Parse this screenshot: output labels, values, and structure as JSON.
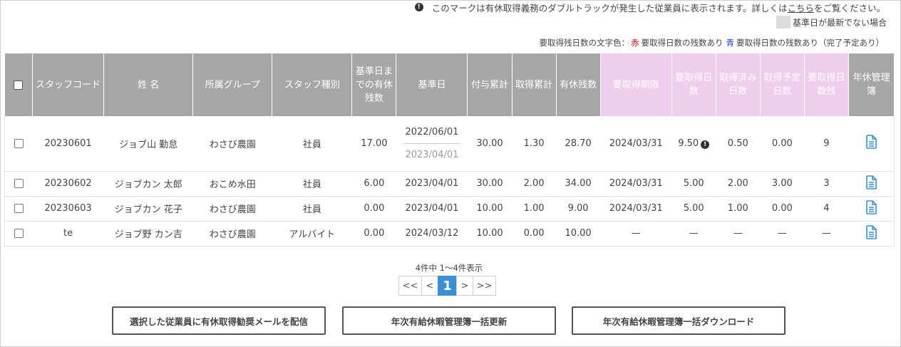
{
  "notice": {
    "icon": "exclamation-circle-icon",
    "text_before": "このマークは有休取得義務のダブルトラックが発生した従業員に表示されます。詳しくは",
    "link": "こちら",
    "text_after": "をご覧ください。"
  },
  "legend": {
    "swatch_color": "#dcdcdc",
    "label": "基準日が最新でない場合"
  },
  "color_legend": {
    "prefix": "要取得残日数の文字色：",
    "red_word": "赤",
    "red_desc": "要取得日数の残数あり",
    "blue_word": "青",
    "blue_desc": "要取得日数の残数あり（完了予定あり）"
  },
  "columns": [
    {
      "key": "check",
      "label": ""
    },
    {
      "key": "staff_code",
      "label": "スタッフコード"
    },
    {
      "key": "name",
      "label": "姓 名"
    },
    {
      "key": "group",
      "label": "所属グループ"
    },
    {
      "key": "staff_type",
      "label": "スタッフ種別"
    },
    {
      "key": "remain_before",
      "label": "基準日までの有休残数"
    },
    {
      "key": "base_date",
      "label": "基準日"
    },
    {
      "key": "granted_total",
      "label": "付与累計"
    },
    {
      "key": "taken_total",
      "label": "取得累計"
    },
    {
      "key": "paid_remain",
      "label": "有休残数"
    },
    {
      "key": "deadline",
      "label": "要取得期限"
    },
    {
      "key": "required_days",
      "label": "要取得日数"
    },
    {
      "key": "taken_days",
      "label": "取得済み日数"
    },
    {
      "key": "planned_days",
      "label": "取得予定日数"
    },
    {
      "key": "required_remain",
      "label": "要取得日数残"
    },
    {
      "key": "ledger",
      "label": "年休管理簿"
    }
  ],
  "rows": [
    {
      "staff_code": "20230601",
      "name": "ジョブ山 勤怠",
      "group": "わさび農園",
      "staff_type": "社員",
      "remain_before": "17.00",
      "base_date": "2022/06/01",
      "base_date_prev": "2023/04/01",
      "granted_total": "30.00",
      "taken_total": "1.30",
      "paid_remain": "28.70",
      "deadline": "2024/03/31",
      "required_days": "9.50",
      "taken_days": "0.50",
      "planned_days": "0.00",
      "required_remain": "9",
      "remain_color": "red"
    },
    {
      "staff_code": "20230602",
      "name": "ジョブカン 太郎",
      "group": "おこめ水田",
      "staff_type": "社員",
      "remain_before": "6.00",
      "base_date": "2023/04/01",
      "granted_total": "30.00",
      "taken_total": "2.00",
      "paid_remain": "34.00",
      "deadline": "2024/03/31",
      "required_days": "5.00",
      "taken_days": "2.00",
      "planned_days": "3.00",
      "required_remain": "3",
      "remain_color": "blue"
    },
    {
      "staff_code": "20230603",
      "name": "ジョブカン 花子",
      "group": "わさび農園",
      "staff_type": "社員",
      "remain_before": "0.00",
      "base_date": "2023/04/01",
      "granted_total": "10.00",
      "taken_total": "1.00",
      "paid_remain": "9.00",
      "deadline": "2024/03/31",
      "required_days": "5.00",
      "taken_days": "1.00",
      "planned_days": "0.00",
      "required_remain": "4",
      "remain_color": "red"
    },
    {
      "staff_code": "te",
      "name": "ジョブ野 カン吉",
      "group": "わさび農園",
      "staff_type": "アルバイト",
      "remain_before": "0.00",
      "base_date": "2024/03/12",
      "granted_total": "10.00",
      "taken_total": "0.00",
      "paid_remain": "10.00",
      "deadline": "—",
      "required_days": "—",
      "taken_days": "—",
      "planned_days": "—",
      "required_remain": "—",
      "remain_color": "none"
    }
  ],
  "pagination": {
    "summary": "4件中 1〜4件表示",
    "first": "<<",
    "prev": "<",
    "current": "1",
    "next": ">",
    "last": ">>"
  },
  "buttons": {
    "send_mail": "選択した従業員に有休取得勧奨メールを配信",
    "bulk_update": "年次有給休暇管理簿一括更新",
    "bulk_download": "年次有給休暇管理簿一括ダウンロード"
  },
  "colors": {
    "header_gray": "#a6a6a6",
    "header_pink": "#efcdec",
    "accent_blue": "#3a8fd6",
    "remain_red": "#d9000d",
    "remain_blue": "#1f3bd1"
  }
}
